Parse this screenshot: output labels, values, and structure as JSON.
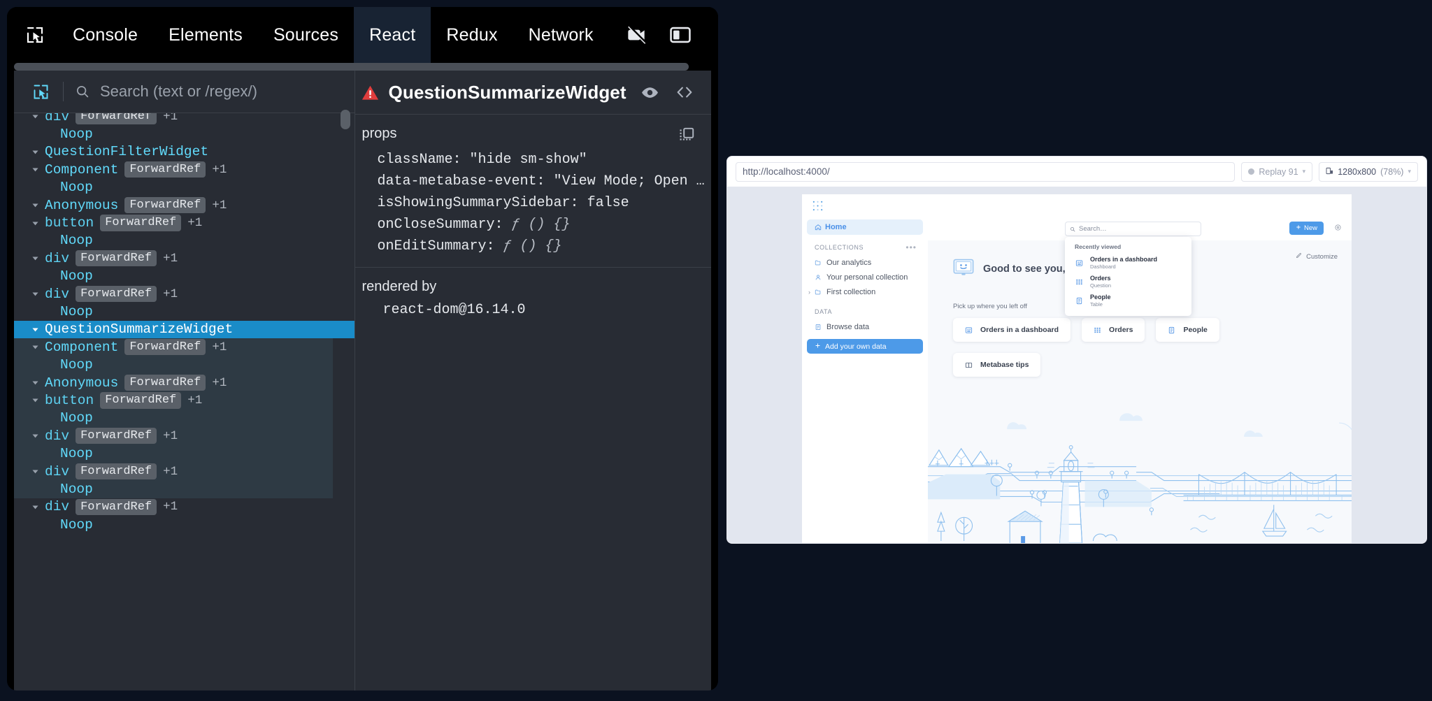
{
  "devtools": {
    "tabs": [
      {
        "label": "Console",
        "active": false
      },
      {
        "label": "Elements",
        "active": false
      },
      {
        "label": "Sources",
        "active": false
      },
      {
        "label": "React",
        "active": true
      },
      {
        "label": "Redux",
        "active": false
      },
      {
        "label": "Network",
        "active": false
      }
    ],
    "inspect_icon": "cursor-select-icon",
    "tool_icons": [
      "video-off-icon",
      "panel-layout-icon"
    ],
    "search": {
      "placeholder": "Search (text or /regex/)",
      "value": "",
      "icon": "search-icon",
      "picker_icon": "cursor-select-icon"
    },
    "tree": [
      {
        "name": "div",
        "badge": "ForwardRef",
        "plus": "+1",
        "indent": 0,
        "arrow": true,
        "dom": true,
        "selected": false,
        "partial": true
      },
      {
        "name": "Noop",
        "badge": "",
        "plus": "",
        "indent": 1,
        "arrow": false,
        "dom": false,
        "selected": false
      },
      {
        "name": "QuestionFilterWidget",
        "badge": "",
        "plus": "",
        "indent": 0,
        "arrow": true,
        "dom": false,
        "selected": false
      },
      {
        "name": "Component",
        "badge": "ForwardRef",
        "plus": "+1",
        "indent": 0,
        "arrow": true,
        "dom": false,
        "selected": false
      },
      {
        "name": "Noop",
        "badge": "",
        "plus": "",
        "indent": 1,
        "arrow": false,
        "dom": false,
        "selected": false
      },
      {
        "name": "Anonymous",
        "badge": "ForwardRef",
        "plus": "+1",
        "indent": 0,
        "arrow": true,
        "dom": false,
        "selected": false
      },
      {
        "name": "button",
        "badge": "ForwardRef",
        "plus": "+1",
        "indent": 0,
        "arrow": true,
        "dom": true,
        "selected": false
      },
      {
        "name": "Noop",
        "badge": "",
        "plus": "",
        "indent": 1,
        "arrow": false,
        "dom": false,
        "selected": false
      },
      {
        "name": "div",
        "badge": "ForwardRef",
        "plus": "+1",
        "indent": 0,
        "arrow": true,
        "dom": true,
        "selected": false
      },
      {
        "name": "Noop",
        "badge": "",
        "plus": "",
        "indent": 1,
        "arrow": false,
        "dom": false,
        "selected": false
      },
      {
        "name": "div",
        "badge": "ForwardRef",
        "plus": "+1",
        "indent": 0,
        "arrow": true,
        "dom": true,
        "selected": false
      },
      {
        "name": "Noop",
        "badge": "",
        "plus": "",
        "indent": 1,
        "arrow": false,
        "dom": false,
        "selected": false
      },
      {
        "name": "QuestionSummarizeWidget",
        "badge": "",
        "plus": "",
        "indent": 0,
        "arrow": true,
        "dom": false,
        "selected": true
      },
      {
        "name": "Component",
        "badge": "ForwardRef",
        "plus": "+1",
        "indent": 0,
        "arrow": true,
        "dom": false,
        "selected": false
      },
      {
        "name": "Noop",
        "badge": "",
        "plus": "",
        "indent": 1,
        "arrow": false,
        "dom": false,
        "selected": false
      },
      {
        "name": "Anonymous",
        "badge": "ForwardRef",
        "plus": "+1",
        "indent": 0,
        "arrow": true,
        "dom": false,
        "selected": false
      },
      {
        "name": "button",
        "badge": "ForwardRef",
        "plus": "+1",
        "indent": 0,
        "arrow": true,
        "dom": true,
        "selected": false
      },
      {
        "name": "Noop",
        "badge": "",
        "plus": "",
        "indent": 1,
        "arrow": false,
        "dom": false,
        "selected": false
      },
      {
        "name": "div",
        "badge": "ForwardRef",
        "plus": "+1",
        "indent": 0,
        "arrow": true,
        "dom": true,
        "selected": false
      },
      {
        "name": "Noop",
        "badge": "",
        "plus": "",
        "indent": 1,
        "arrow": false,
        "dom": false,
        "selected": false
      },
      {
        "name": "div",
        "badge": "ForwardRef",
        "plus": "+1",
        "indent": 0,
        "arrow": true,
        "dom": true,
        "selected": false
      },
      {
        "name": "Noop",
        "badge": "",
        "plus": "",
        "indent": 1,
        "arrow": false,
        "dom": false,
        "selected": false
      },
      {
        "name": "div",
        "badge": "ForwardRef",
        "plus": "+1",
        "indent": 0,
        "arrow": true,
        "dom": true,
        "selected": false
      },
      {
        "name": "Noop",
        "badge": "",
        "plus": "",
        "indent": 1,
        "arrow": false,
        "dom": false,
        "selected": false
      }
    ],
    "inspector": {
      "component_name": "QuestionSummarizeWidget",
      "warning_icon": "warning-triangle-icon",
      "header_icons": [
        "eye-icon",
        "code-brackets-icon"
      ],
      "props_section": {
        "title": "props",
        "copy_icon": "copy-icon",
        "entries": [
          {
            "key": "className:",
            "value": "\"hide sm-show\"",
            "type": "string"
          },
          {
            "key": "data-metabase-event:",
            "value": "\"View Mode; Open …",
            "type": "string"
          },
          {
            "key": "isShowingSummarySidebar:",
            "value": "false",
            "type": "bool"
          },
          {
            "key": "onCloseSummary:",
            "value": "ƒ () {}",
            "type": "fn"
          },
          {
            "key": "onEditSummary:",
            "value": "ƒ () {}",
            "type": "fn"
          }
        ]
      },
      "rendered_by": {
        "title": "rendered by",
        "value": "react-dom@16.14.0"
      }
    }
  },
  "preview": {
    "url": "http://localhost:4000/",
    "replay_label": "Replay 91",
    "resolution_label": "1280x800",
    "zoom_label": "(78%)",
    "caret": "▾",
    "app": {
      "logo_icon": "metabase-logo-icon",
      "sidebar": {
        "home": {
          "label": "Home",
          "icon": "home-icon"
        },
        "collections_header": {
          "label": "COLLECTIONS",
          "menu_icon": "ellipsis-icon"
        },
        "collections": [
          {
            "label": "Our analytics",
            "icon": "folder-icon",
            "chevron": false
          },
          {
            "label": "Your personal collection",
            "icon": "person-icon",
            "chevron": false
          },
          {
            "label": "First collection",
            "icon": "folder-icon",
            "chevron": true
          }
        ],
        "data_header": {
          "label": "DATA"
        },
        "data_items": [
          {
            "label": "Browse data",
            "icon": "database-icon"
          }
        ],
        "add_data_button": {
          "label": "Add your own data",
          "icon": "plus-icon"
        }
      },
      "topbar": {
        "search_placeholder": "Search…",
        "search_icon": "search-icon",
        "new_button": {
          "label": "New",
          "icon": "plus-icon"
        },
        "settings_icon": "gear-icon"
      },
      "recently_viewed": {
        "title": "Recently viewed",
        "items": [
          {
            "name": "Orders in a dashboard",
            "type": "Dashboard",
            "icon": "dashboard-icon"
          },
          {
            "name": "Orders",
            "type": "Question",
            "icon": "table-grid-icon"
          },
          {
            "name": "People",
            "type": "Table",
            "icon": "table-icon"
          }
        ]
      },
      "greeting": {
        "text": "Good to see you, Bobby",
        "icon": "smiling-monitor-icon"
      },
      "customize": {
        "label": "Customize",
        "icon": "pencil-icon"
      },
      "pick_up_label": "Pick up where you left off",
      "cards": [
        {
          "label": "Orders in a dashboard",
          "icon": "dashboard-icon"
        },
        {
          "label": "Orders",
          "icon": "table-grid-icon"
        },
        {
          "label": "People",
          "icon": "table-icon"
        },
        {
          "label": "Metabase tips",
          "icon": "book-icon"
        }
      ],
      "illustration": "lighthouse-coastal-illustration"
    }
  },
  "colors": {
    "devtools_bg": "#282c34",
    "devtools_chrome": "#000000",
    "selection": "#1a8cc8",
    "subtree_band": "#2e3a44",
    "component_name": "#61dafb",
    "accent_blue": "#4d9ae8",
    "warning_red": "#e03d3d",
    "page_bg": "#0b1220"
  }
}
